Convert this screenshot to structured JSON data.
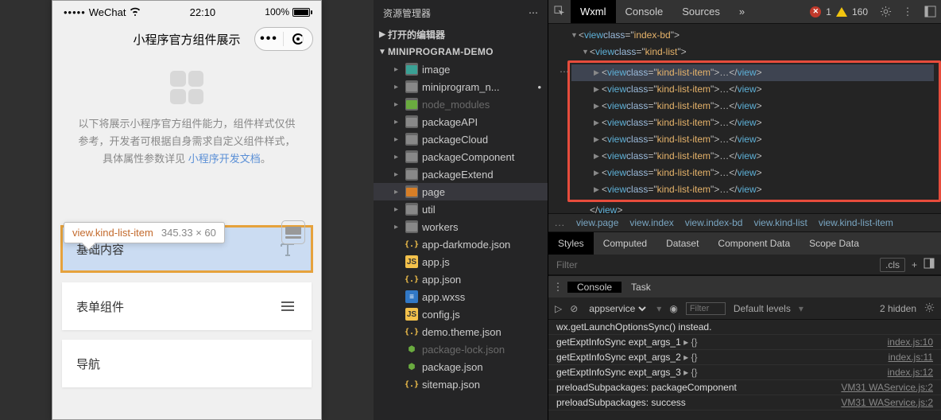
{
  "status": {
    "carrier_dots": "•••••",
    "carrier": "WeChat",
    "time": "22:10",
    "battery_pct": "100%"
  },
  "nav": {
    "title": "小程序官方组件展示",
    "more": "•••"
  },
  "intro": {
    "line1": "以下将展示小程序官方组件能力，组件样式仅供",
    "line2": "参考，开发者可根据自身需求自定义组件样式，",
    "line3_a": "具体属性参数详见 ",
    "line3_link": "小程序开发文档",
    "line3_b": "。"
  },
  "tooltip": {
    "selector": "view.kind-list-item",
    "size": "345.33 × 60"
  },
  "kind_items": [
    {
      "label": "基础内容",
      "icon": "text"
    },
    {
      "label": "表单组件",
      "icon": "form"
    },
    {
      "label": "导航",
      "icon": "nav"
    }
  ],
  "explorer": {
    "title": "资源管理器",
    "open_editors": "打开的编辑器",
    "project": "MINIPROGRAM-DEMO",
    "tree": [
      {
        "name": "image",
        "kind": "folder",
        "depth": 2,
        "color": "teal"
      },
      {
        "name": "miniprogram_n...",
        "kind": "folder",
        "depth": 2,
        "dim": false,
        "dot": true
      },
      {
        "name": "node_modules",
        "kind": "folder",
        "depth": 2,
        "color": "green",
        "dim": true
      },
      {
        "name": "packageAPI",
        "kind": "folder",
        "depth": 2
      },
      {
        "name": "packageCloud",
        "kind": "folder",
        "depth": 2
      },
      {
        "name": "packageComponent",
        "kind": "folder",
        "depth": 2
      },
      {
        "name": "packageExtend",
        "kind": "folder",
        "depth": 2
      },
      {
        "name": "page",
        "kind": "folder",
        "depth": 2,
        "color": "orange",
        "sel": true
      },
      {
        "name": "util",
        "kind": "folder",
        "depth": 2
      },
      {
        "name": "workers",
        "kind": "folder",
        "depth": 2
      },
      {
        "name": "app-darkmode.json",
        "kind": "jsonb",
        "depth": 2
      },
      {
        "name": "app.js",
        "kind": "js",
        "depth": 2
      },
      {
        "name": "app.json",
        "kind": "jsonb",
        "depth": 2
      },
      {
        "name": "app.wxss",
        "kind": "wxss",
        "depth": 2
      },
      {
        "name": "config.js",
        "kind": "js",
        "depth": 2
      },
      {
        "name": "demo.theme.json",
        "kind": "jsonb",
        "depth": 2
      },
      {
        "name": "package-lock.json",
        "kind": "node",
        "depth": 2,
        "dim": true
      },
      {
        "name": "package.json",
        "kind": "node",
        "depth": 2
      },
      {
        "name": "sitemap.json",
        "kind": "jsonb",
        "depth": 2
      }
    ]
  },
  "devtools": {
    "tabs": [
      "Wxml",
      "Console",
      "Sources"
    ],
    "more": "»",
    "error_count": "1",
    "warn_count": "160",
    "elements": {
      "header1": {
        "tag": "view",
        "attr": "class",
        "val": "index-bd"
      },
      "header2": {
        "tag": "view",
        "attr": "class",
        "val": "kind-list"
      },
      "item_count": 8,
      "item": {
        "tag": "view",
        "attr": "class",
        "val": "kind-list-item"
      },
      "close2": "</view>"
    },
    "crumbs": [
      "...",
      "view.page",
      "view.index",
      "view.index-bd",
      "view.kind-list",
      "view.kind-list-item"
    ],
    "styles_tabs": [
      "Styles",
      "Computed",
      "Dataset",
      "Component Data",
      "Scope Data"
    ],
    "filter_placeholder": "Filter",
    "cls": ".cls",
    "drawer_tabs": [
      "Console",
      "Task"
    ],
    "console_ctx": "appservice",
    "console_filter_placeholder": "Filter",
    "console_levels": "Default levels",
    "console_hidden": "2 hidden",
    "console_rows": [
      {
        "msg_a": "wx.getLaunchOptionsSync()",
        "msg_b": " instead.",
        "src": ""
      },
      {
        "msg_a": "getExptInfoSync expt_args_1",
        "obj": "▸ {}",
        "src": "index.js:10"
      },
      {
        "msg_a": "getExptInfoSync expt_args_2",
        "obj": "▸ {}",
        "src": "index.js:11"
      },
      {
        "msg_a": "getExptInfoSync expt_args_3",
        "obj": "▸ {}",
        "src": "index.js:12"
      },
      {
        "msg_a": "preloadSubpackages: packageComponent",
        "src": "VM31 WAService.js:2"
      },
      {
        "msg_a": "preloadSubpackages: success",
        "src": "VM31 WAService.js:2"
      }
    ]
  }
}
